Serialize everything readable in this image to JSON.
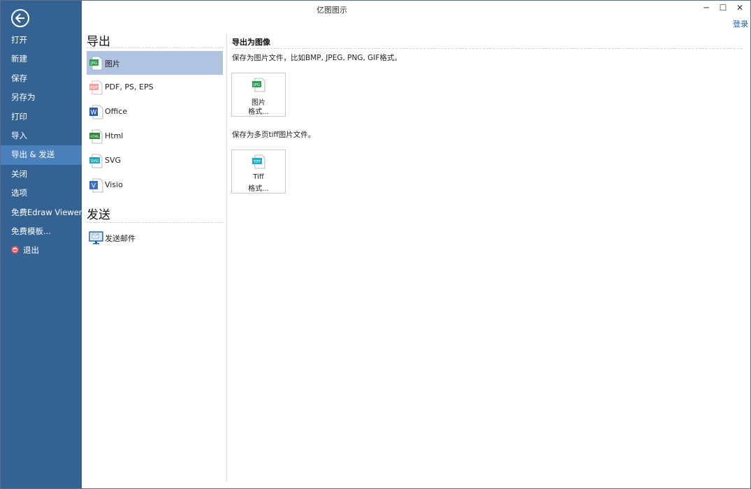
{
  "window": {
    "title": "亿图图示",
    "minimize": "─",
    "maximize": "☐",
    "close": "✕",
    "login": "登录"
  },
  "sidebar": {
    "back_icon": "back-arrow-icon",
    "items": [
      {
        "label": "打开"
      },
      {
        "label": "新建"
      },
      {
        "label": "保存"
      },
      {
        "label": "另存为"
      },
      {
        "label": "打印"
      },
      {
        "label": "导入"
      },
      {
        "label": "导出 & 发送",
        "active": true
      },
      {
        "label": "关闭"
      },
      {
        "label": "选项"
      },
      {
        "label": "免费Edraw Viewer"
      },
      {
        "label": "免费模板..."
      },
      {
        "label": "退出",
        "icon": "exit-icon"
      }
    ]
  },
  "export": {
    "heading": "导出",
    "items": [
      {
        "label": "图片",
        "icon": "jpg-file-icon",
        "selected": true
      },
      {
        "label": "PDF, PS, EPS",
        "icon": "pdf-file-icon"
      },
      {
        "label": "Office",
        "icon": "word-file-icon"
      },
      {
        "label": "Html",
        "icon": "html-file-icon"
      },
      {
        "label": "SVG",
        "icon": "svg-file-icon"
      },
      {
        "label": "Visio",
        "icon": "visio-file-icon"
      }
    ]
  },
  "send": {
    "heading": "发送",
    "items": [
      {
        "label": "发送邮件",
        "icon": "email-monitor-icon"
      }
    ]
  },
  "panel": {
    "title": "导出为图像",
    "image_desc": "保存为图片文件，比如BMP, JPEG, PNG, GIF格式。",
    "image_button": {
      "line1": "图片",
      "line2": "格式...",
      "icon": "jpg-file-icon"
    },
    "tiff_desc": "保存为多页tiff图片文件。",
    "tiff_button": {
      "line1": "Tiff",
      "line2": "格式...",
      "icon": "tiff-file-icon"
    }
  },
  "icon_badges": {
    "jpg": "JPG",
    "pdf": "PDF",
    "word": "W",
    "html": "HTML",
    "svg": "SVG",
    "visio": "V",
    "tiff": "TIFF"
  },
  "colors": {
    "sidebar_bg": "#336293",
    "sidebar_active": "#4a81bd",
    "selected_item": "#b1c3e2",
    "link": "#1a5fc7",
    "jpg_green": "#2e9f4c",
    "pdf_red": "#e06a6a",
    "word_blue": "#2b5fae",
    "html_green": "#2f8a3a",
    "svg_teal": "#24a6b5",
    "visio_blue": "#3a6fc0",
    "tiff_teal": "#1fb0c4"
  }
}
